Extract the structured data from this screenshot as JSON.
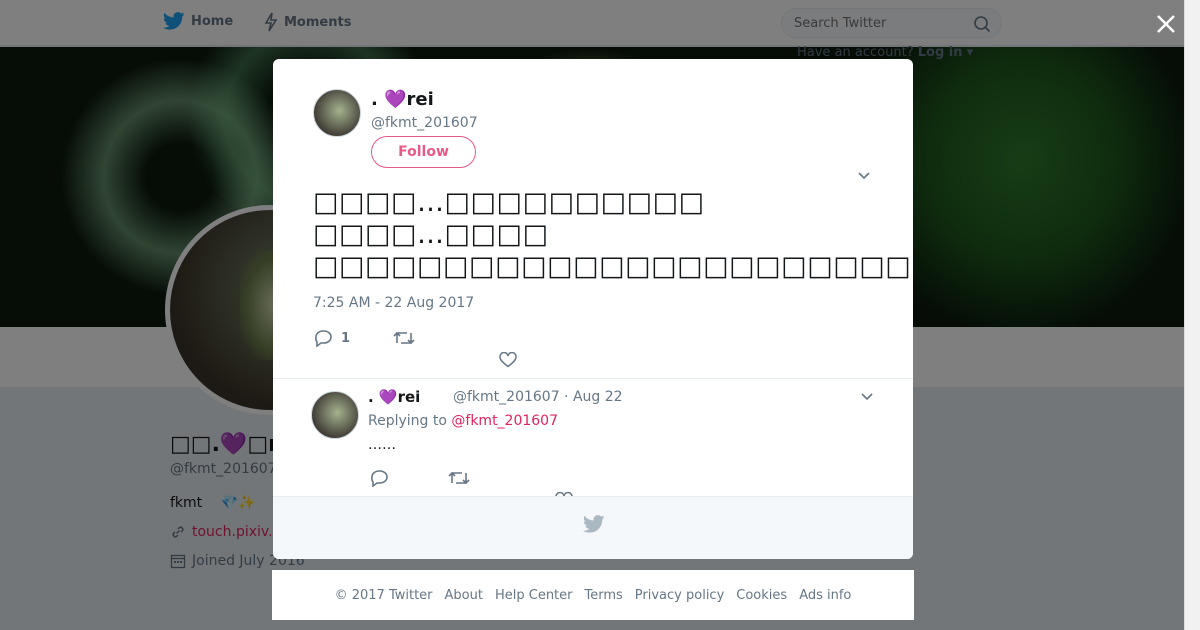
{
  "nav": {
    "home_label": "Home",
    "moments_label": "Moments",
    "search_placeholder": "Search Twitter",
    "have_account": "Have an account?",
    "login_label": "Log in"
  },
  "profile": {
    "name": "□□.💜□rei",
    "handle": "@fkmt_201607",
    "bio": "fkmt　 💎✨",
    "link": "touch.pixiv.",
    "joined": "Joined July 2016"
  },
  "modal": {
    "tweet": {
      "name": ".  💜rei",
      "handle": "@fkmt_201607",
      "follow_label": "Follow",
      "lines": [
        "□□□□…□□□□□□□□□□",
        "□□□□…□□□□",
        "□□□□□□□□□□□□□□□□□□□□□□□□□□□□□□□□"
      ],
      "timestamp": "7:25 AM - 22 Aug 2017",
      "reply_count": "1"
    },
    "reply": {
      "name": ".  💜rei",
      "meta": "@fkmt_201607 · Aug 22",
      "replying_to_prefix": "Replying to",
      "replying_to_handle": "@fkmt_201607",
      "text": "……"
    }
  },
  "footer": {
    "items": [
      "© 2017 Twitter",
      "About",
      "Help Center",
      "Terms",
      "Privacy policy",
      "Cookies",
      "Ads info"
    ]
  },
  "colors": {
    "accent": "#e0245e",
    "muted": "#657786",
    "twitter_blue": "#1da1f2"
  }
}
